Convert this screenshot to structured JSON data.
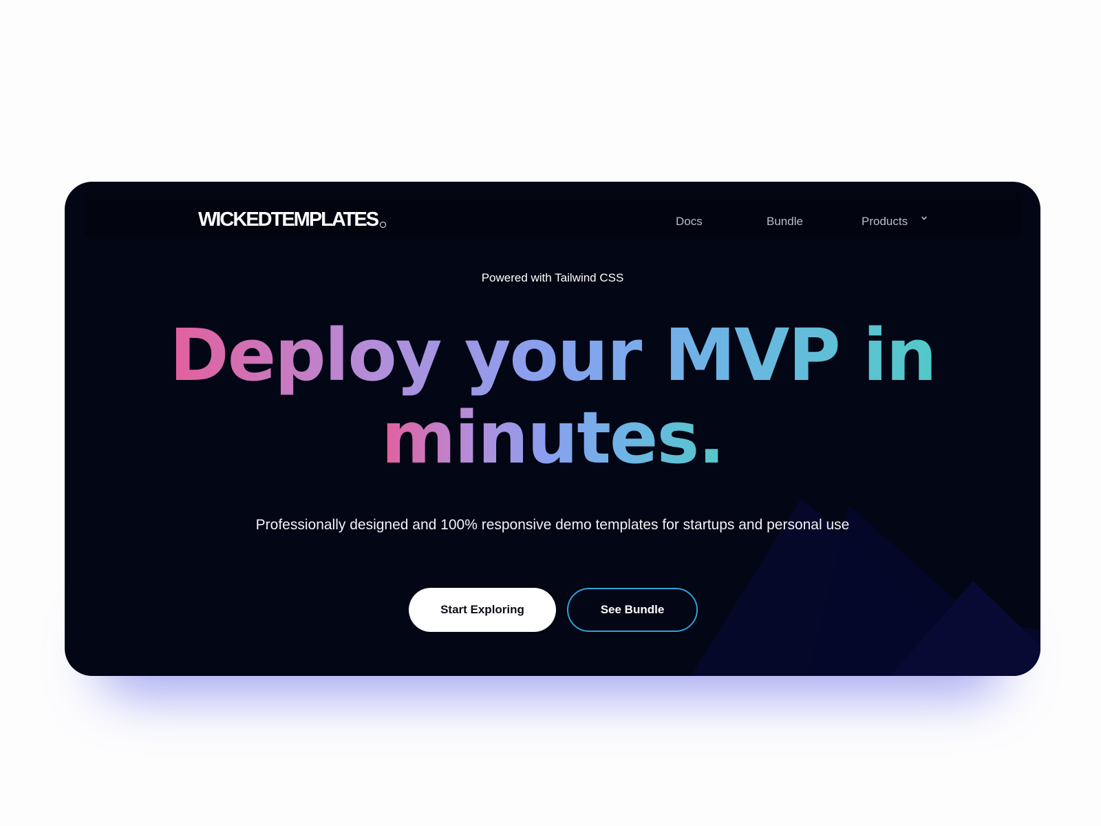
{
  "brand": {
    "name": "WICKEDTEMPLATES",
    "mark": "c"
  },
  "nav": {
    "items": [
      {
        "label": "Docs"
      },
      {
        "label": "Bundle"
      },
      {
        "label": "Products"
      }
    ]
  },
  "hero": {
    "eyebrow": "Powered with Tailwind CSS",
    "headline_line1": "Deploy your MVP in",
    "headline_line2": "minutes.",
    "subtext": "Professionally designed and 100% responsive demo templates for startups and personal use",
    "primary_button": "Start Exploring",
    "secondary_button": "See Bundle"
  },
  "colors": {
    "page_background": "#fdfdfe",
    "card_background": "#030614",
    "gradient_start": "#e35f9c",
    "gradient_end": "#52c9c8",
    "secondary_button_border": "#2ea3d9",
    "shadow_glow": "#5c62e8"
  }
}
